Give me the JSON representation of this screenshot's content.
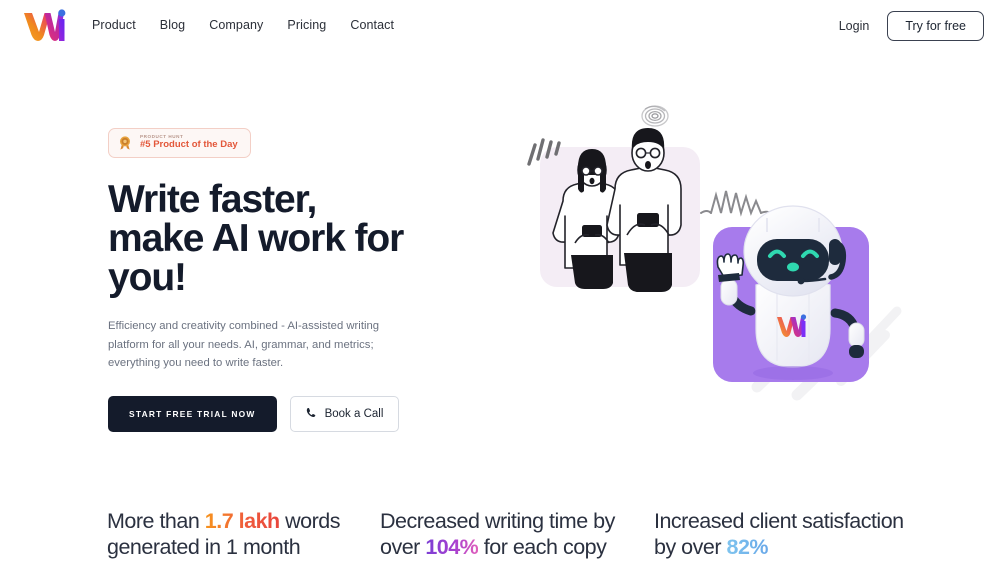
{
  "brand": {
    "logo_alt": "WAI logo",
    "gradient_start": "#f7a11a",
    "gradient_mid": "#e8346e",
    "gradient_end": "#7b2ff7",
    "dot_color": "#3b6fe0"
  },
  "nav": {
    "links": [
      {
        "label": "Product"
      },
      {
        "label": "Blog"
      },
      {
        "label": "Company"
      },
      {
        "label": "Pricing"
      },
      {
        "label": "Contact"
      }
    ],
    "login_label": "Login",
    "cta_label": "Try for free"
  },
  "hero": {
    "badge": {
      "kicker": "PRODUCT HUNT",
      "title": "#5 Product of the Day",
      "icon": "medal-icon",
      "border_color": "#f3cfc6",
      "background": "#fdf7f5",
      "text_color": "#e3573a"
    },
    "title_line_1": "Write faster,",
    "title_line_2": "make AI work for",
    "title_line_3": "you!",
    "title_full": "Write faster, make AI work for you!",
    "subtitle": "Efficiency and creativity combined - AI-assisted writing platform for all your needs. AI, grammar, and metrics; everything you need to write faster.",
    "primary_cta": "START FREE TRIAL NOW",
    "secondary_cta": "Book a Call",
    "secondary_icon": "phone-icon",
    "illustration": {
      "people_panel_color": "#f4edf5",
      "robot_panel_color": "#a77bec",
      "robot_face_color": "#1e2b3d",
      "robot_eye_color": "#2fd8b0",
      "scribble_color": "#8b8b8b"
    }
  },
  "stats": [
    {
      "prefix": "More than ",
      "highlight": "1.7 lakh",
      "highlight_style": "orange",
      "suffix": " words generated in 1 month"
    },
    {
      "prefix": "Decreased writing time by over ",
      "highlight": "104%",
      "highlight_style": "purple",
      "suffix": " for each copy"
    },
    {
      "prefix": "Increased client satisfaction by over ",
      "highlight": "82%",
      "highlight_style": "blue",
      "suffix": ""
    }
  ]
}
